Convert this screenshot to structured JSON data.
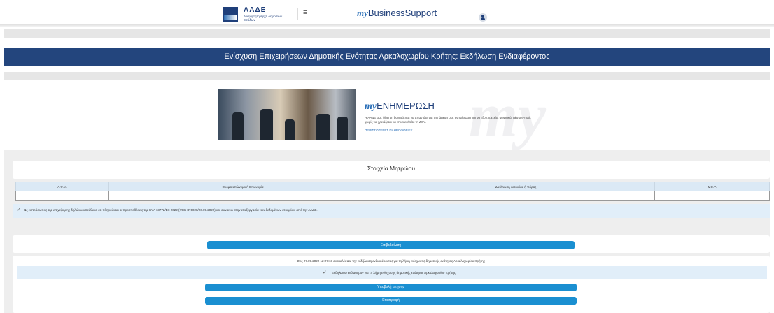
{
  "header": {
    "logo_title": "ΑΑΔΕ",
    "logo_subtitle": "Ανεξάρτητη Αρχή Δημοσίων Εσόδων",
    "menu_icon": "hamburger-icon",
    "brand_my": "my",
    "brand_rest": "BusinessSupport",
    "user_icon": "user-icon"
  },
  "page": {
    "title": "Ενίσχυση Επιχειρήσεων Δημοτικής Ενότητας Αρκαλοχωρίου Κρήτης: Εκδήλωση Ενδιαφέροντος"
  },
  "banner": {
    "title_my": "my",
    "title_rest": "ΕΝΗΜΕΡΩΣΗ",
    "description": "Η ΑΑΔΕ σας δίνει τη δυνατότητα να απαντάτε για την άμεση σας ενημέρωση και να εξυπηρετείτε ψηφιακά, μέσω e-mail, χωρίς να χρειάζεται να επισκεφθείτε τη ΔΟΥ.",
    "more_link": "ΠΕΡΙΣΣΟΤΕΡΕΣ ΠΛΗΡΟΦΟΡΙΕΣ",
    "watermark": "my"
  },
  "registry": {
    "title": "Στοιχεία Μητρώου",
    "columns": [
      "Α.Φ.Μ.",
      "Ονοματεπώνυμο ή Επωνυμία",
      "Διεύθυνση κατοικίας ή Έδρας",
      "Δ.Ο.Υ."
    ],
    "row": [
      "",
      "",
      "",
      ""
    ]
  },
  "consent": {
    "checked": true,
    "text": "Ως εκπρόσωπος της επιχείρησης δηλώνω υπεύθυνα ότι πληρούνται οι προϋποθέσεις της ΚΥΑ 13772/ΕΞ 2022 (ΦΕΚ Β' 5028/26.09.2022) και συναινώ στην επεξεργασία των δεδομένων στοιχείων από την ΑΑΔΕ."
  },
  "actions": {
    "confirm_label": "Επιβεβαίωση",
    "status_text": "Στις 27.09.2022 12:27:18 ανακαλέσατε την εκδήλωση ενδιαφέροντος για τη λήψη ενίσχυσης δημοτικής ενότητας Αρκαλοχωρίου Κρήτης",
    "interest_checked": true,
    "interest_text": "Εκδηλώνω ενδιαφέρον για τη λήψη ενίσχυσης δημοτικής ενότητας Αρκαλοχωρίου Κρήτης",
    "submit_label": "Υποβολή αίτησης",
    "back_label": "Επιστροφή"
  }
}
